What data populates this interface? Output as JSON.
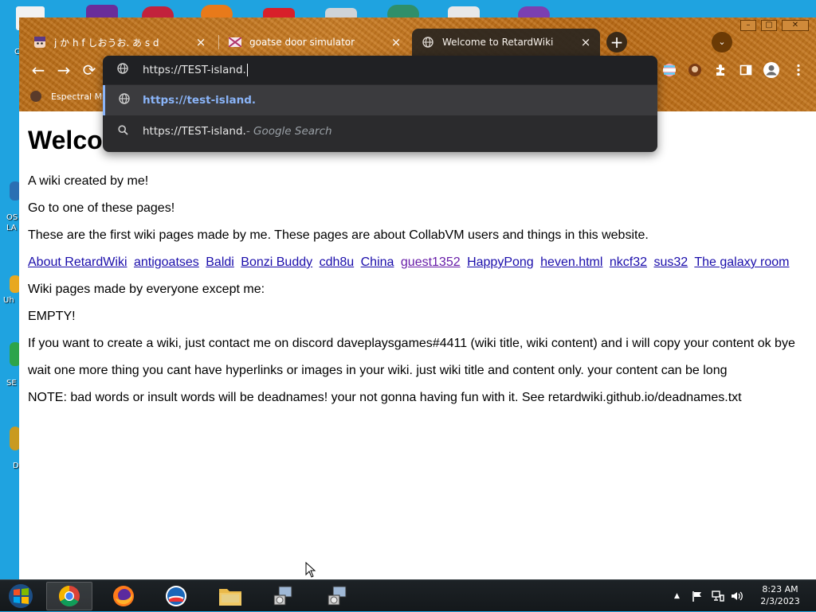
{
  "tabs": [
    {
      "title": "j か h f しおうお. あ s d",
      "close": "×"
    },
    {
      "title": "goatse door simulator",
      "close": "×"
    },
    {
      "title": "Welcome to RetardWiki",
      "close": "×"
    }
  ],
  "new_tab_label": "+",
  "tab_search_label": "⌄",
  "window_controls": {
    "minimize": "–",
    "maximize": "▢",
    "close": "✕"
  },
  "nav": {
    "back": "←",
    "forward": "→",
    "reload": "⟳"
  },
  "bookmark": {
    "label": "Espectral Ma"
  },
  "omnibox": {
    "input_value": "https://TEST-island.",
    "suggestion_url": "https://test-island.",
    "search_query": "https://TEST-island.",
    "search_suffix": " - Google Search"
  },
  "page": {
    "heading": "Welco",
    "intro": "A wiki created by me!",
    "go_to": "Go to one of these pages!",
    "first_pages": "These are the first wiki pages made by me. These pages are about CollabVM users and things in this website.",
    "links": [
      {
        "label": "About RetardWiki",
        "visited": false
      },
      {
        "label": "antigoatses",
        "visited": false
      },
      {
        "label": "Baldi",
        "visited": false
      },
      {
        "label": "Bonzi Buddy",
        "visited": false
      },
      {
        "label": "cdh8u",
        "visited": false
      },
      {
        "label": "China",
        "visited": false
      },
      {
        "label": "guest1352",
        "visited": true
      },
      {
        "label": "HappyPong",
        "visited": false
      },
      {
        "label": "heven.html",
        "visited": false
      },
      {
        "label": "nkcf32",
        "visited": false
      },
      {
        "label": "sus32",
        "visited": false
      },
      {
        "label": "The galaxy room",
        "visited": false
      }
    ],
    "everyone_heading": "Wiki pages made by everyone except me:",
    "empty": "EMPTY!",
    "contact": "If you want to create a wiki, just contact me on discord daveplaysgames#4411 (wiki title, wiki content) and i will copy your content ok bye",
    "one_more": "wait one more thing you cant have hyperlinks or images in your wiki. just wiki title and content only. your content can be long",
    "note": "NOTE: bad words or insult words will be deadnames! your not gonna having fun with it. See retardwiki.github.io/deadnames.txt"
  },
  "desktop_labels": [
    "C",
    "OS",
    "LA",
    "Uh",
    "SE",
    "D"
  ],
  "taskbar": {
    "clock_time": "8:23 AM",
    "clock_date": "2/3/2023",
    "tray_chevron": "▲"
  },
  "colors": {
    "desktop": "#1fa3e0",
    "frame_orange": "#c27420",
    "omnibox_bg": "#2b2b2d",
    "link": "#1a0dab",
    "visited_link": "#681da8",
    "suggestion": "#8ab4f8"
  },
  "icons": [
    "globe-icon",
    "search-icon",
    "extensions-icon",
    "profile-icon",
    "menu-icon",
    "reload-icon"
  ]
}
